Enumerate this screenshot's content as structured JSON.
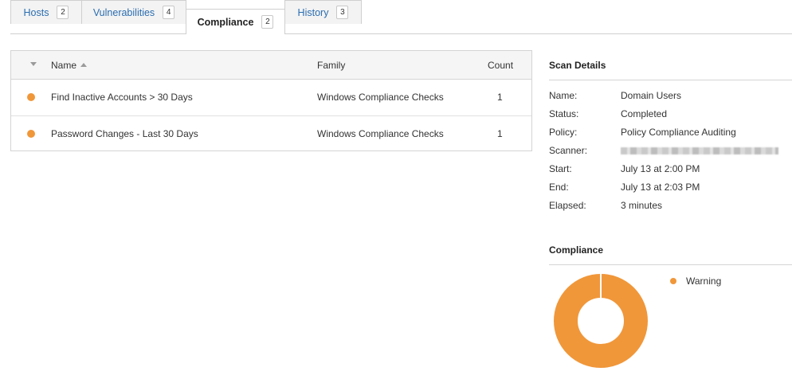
{
  "tabs": [
    {
      "label": "Hosts",
      "count": "2"
    },
    {
      "label": "Vulnerabilities",
      "count": "4"
    },
    {
      "label": "Compliance",
      "count": "2"
    },
    {
      "label": "History",
      "count": "3"
    }
  ],
  "table": {
    "headers": {
      "name": "Name",
      "family": "Family",
      "count": "Count"
    },
    "rows": [
      {
        "name": "Find Inactive Accounts > 30 Days",
        "family": "Windows Compliance Checks",
        "count": "1",
        "status": "warning"
      },
      {
        "name": "Password Changes - Last 30 Days",
        "family": "Windows Compliance Checks",
        "count": "1",
        "status": "warning"
      }
    ]
  },
  "scan_details": {
    "title": "Scan Details",
    "fields": [
      {
        "key": "Name:",
        "value": "Domain Users"
      },
      {
        "key": "Status:",
        "value": "Completed"
      },
      {
        "key": "Policy:",
        "value": "Policy Compliance Auditing"
      },
      {
        "key": "Scanner:",
        "value": ""
      },
      {
        "key": "Start:",
        "value": "July 13 at 2:00 PM"
      },
      {
        "key": "End:",
        "value": "July 13 at 2:03 PM"
      },
      {
        "key": "Elapsed:",
        "value": "3 minutes"
      }
    ]
  },
  "compliance": {
    "title": "Compliance",
    "legend": [
      {
        "label": "Warning",
        "color": "#f0973a"
      }
    ],
    "chart_data": {
      "type": "pie",
      "categories": [
        "Warning"
      ],
      "values": [
        2
      ]
    }
  },
  "colors": {
    "warning": "#f0973a",
    "link": "#2a6db0"
  }
}
